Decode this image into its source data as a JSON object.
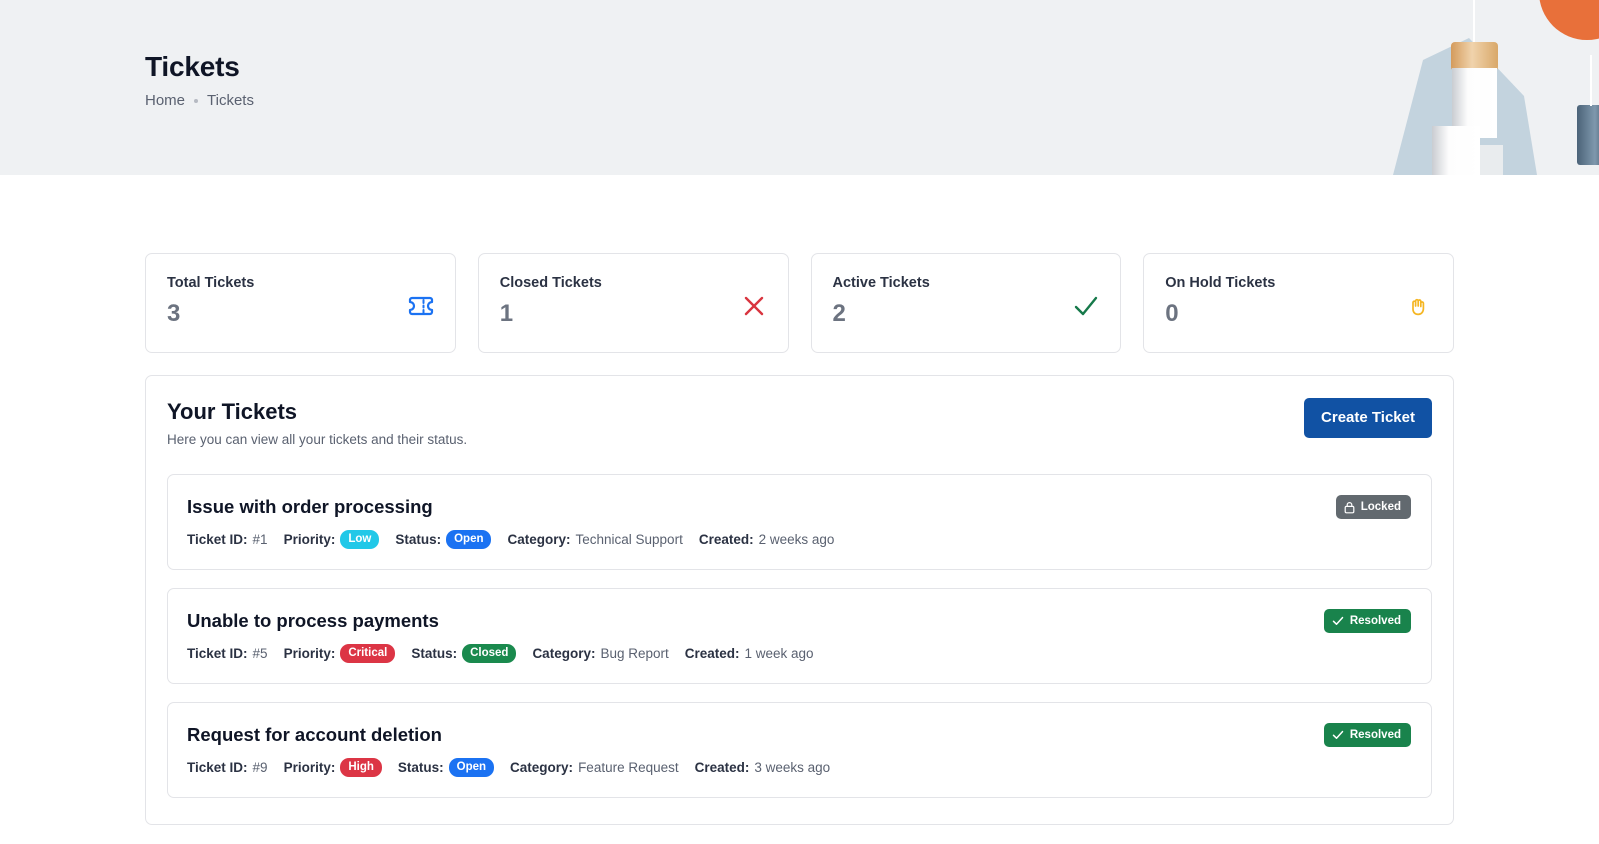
{
  "header": {
    "title": "Tickets",
    "breadcrumb": {
      "home": "Home",
      "current": "Tickets"
    },
    "background_color": "#eff1f3"
  },
  "stats": [
    {
      "label": "Total Tickets",
      "value": "3",
      "icon": "ticket-icon",
      "icon_color": "#1b72f2"
    },
    {
      "label": "Closed Tickets",
      "value": "1",
      "icon": "x-mark-icon",
      "icon_color": "#d9353f"
    },
    {
      "label": "Active Tickets",
      "value": "2",
      "icon": "check-icon",
      "icon_color": "#16794a"
    },
    {
      "label": "On Hold Tickets",
      "value": "0",
      "icon": "hand-pause-icon",
      "icon_color": "#f5b623"
    }
  ],
  "panel": {
    "title": "Your Tickets",
    "subtitle": "Here you can view all your tickets and their status.",
    "create_button": "Create Ticket",
    "create_button_color": "#1152a4"
  },
  "labels": {
    "ticket_id": "Ticket ID:",
    "priority": "Priority:",
    "status": "Status:",
    "category": "Category:",
    "created": "Created:"
  },
  "tickets": [
    {
      "title": "Issue with order processing",
      "id": "#1",
      "priority": "Low",
      "priority_color": "#21c8e8",
      "status": "Open",
      "status_color": "#1b72f2",
      "category": "Technical Support",
      "created": "2 weeks ago",
      "badge": {
        "label": "Locked",
        "icon": "lock-icon",
        "color": "#62696f"
      }
    },
    {
      "title": "Unable to process payments",
      "id": "#5",
      "priority": "Critical",
      "priority_color": "#dc3545",
      "status": "Closed",
      "status_color": "#1a8a4e",
      "category": "Bug Report",
      "created": "1 week ago",
      "badge": {
        "label": "Resolved",
        "icon": "check-icon",
        "color": "#19834c"
      }
    },
    {
      "title": "Request for account deletion",
      "id": "#9",
      "priority": "High",
      "priority_color": "#dc3545",
      "status": "Open",
      "status_color": "#1b72f2",
      "category": "Feature Request",
      "created": "3 weeks ago",
      "badge": {
        "label": "Resolved",
        "icon": "check-icon",
        "color": "#19834c"
      }
    }
  ]
}
